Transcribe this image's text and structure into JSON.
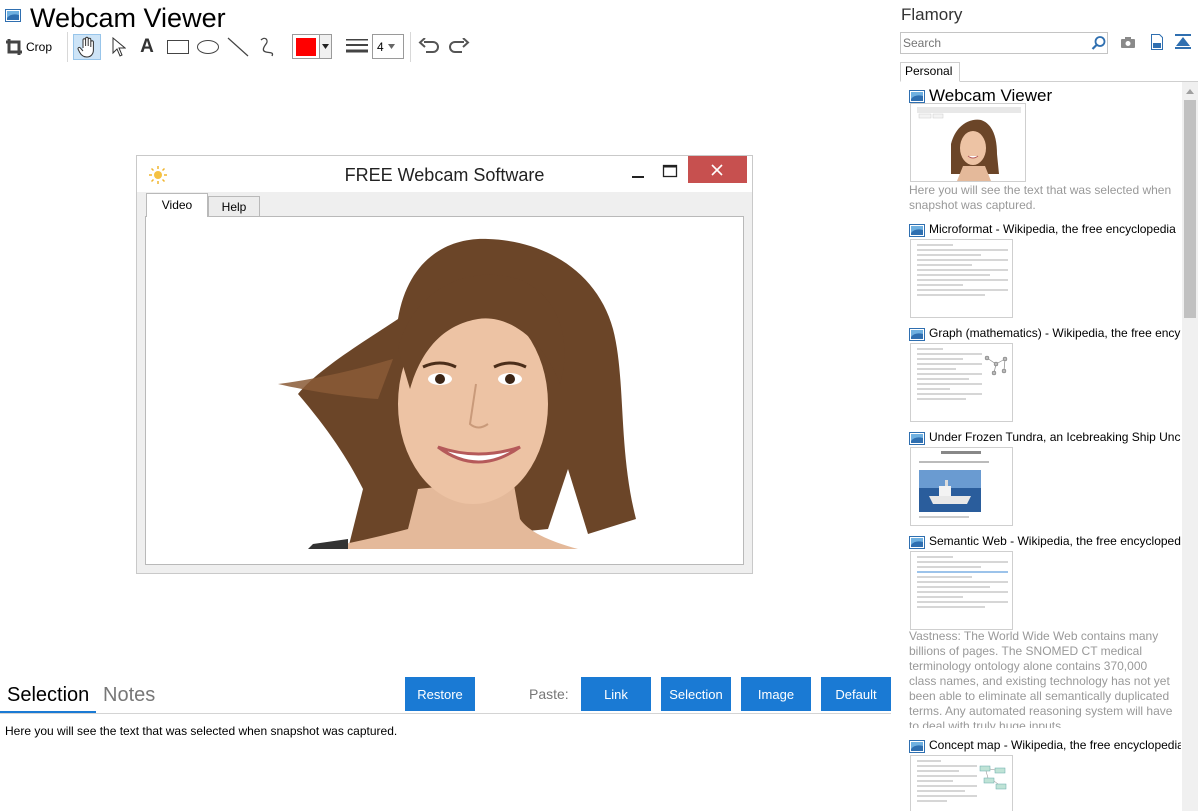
{
  "app": {
    "title": "Webcam Viewer"
  },
  "toolbar": {
    "crop_label": "Crop",
    "text_tool_label": "A",
    "color": "#ff0000",
    "line_width": "4"
  },
  "snapshot_window": {
    "title": "FREE Webcam Software",
    "tabs": [
      "Video",
      "Help"
    ]
  },
  "bottom": {
    "tabs": [
      "Selection",
      "Notes"
    ],
    "active_tab": "Selection",
    "restore_label": "Restore",
    "paste_label": "Paste:",
    "paste_buttons": [
      "Link",
      "Selection",
      "Image",
      "Default"
    ],
    "selection_text": "Here you will see the text that was selected when snapshot was captured."
  },
  "side": {
    "title": "Flamory",
    "search_placeholder": "Search",
    "tab": "Personal",
    "items": [
      {
        "title": "Webcam Viewer",
        "description": "Here you will see the text that was selected when snapshot was captured."
      },
      {
        "title": "Microformat - Wikipedia, the free encyclopedia"
      },
      {
        "title": "Graph (mathematics) - Wikipedia, the free ency"
      },
      {
        "title": "Under Frozen Tundra, an Icebreaking Ship Unco"
      },
      {
        "title": "Semantic Web - Wikipedia, the free encycloped",
        "description": "Vastness: The World Wide Web contains many billions of pages. The SNOMED CT medical terminology ontology alone contains 370,000 class names, and existing technology has not yet been able to eliminate all semantically duplicated terms. Any automated reasoning system will have to deal with truly huge inputs."
      },
      {
        "title": "Concept map - Wikipedia, the free encyclopedia"
      }
    ]
  },
  "colors": {
    "accent": "#1a7ad4",
    "close_button": "#c7504f",
    "selected_tool": "#cde4f7"
  }
}
